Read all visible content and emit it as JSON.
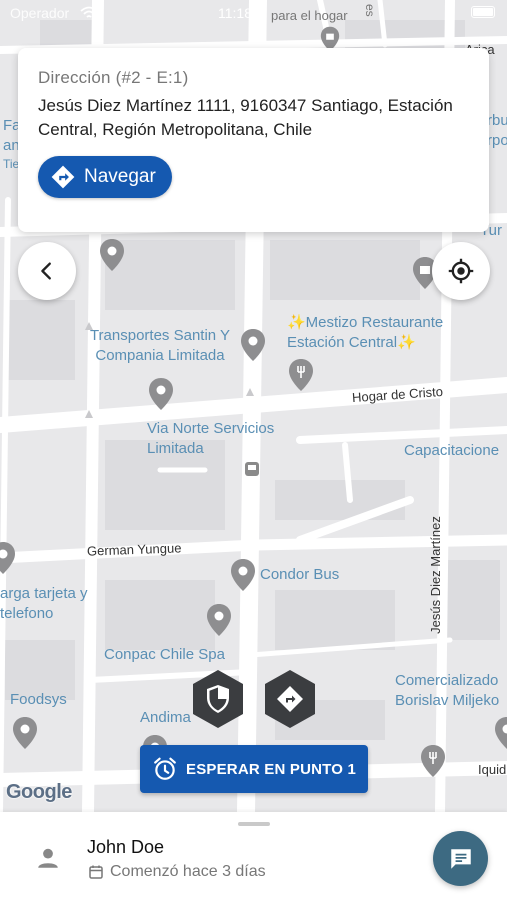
{
  "status_bar": {
    "carrier": "Operador",
    "time": "11:18"
  },
  "address_card": {
    "label": "Dirección (#2 - E:1)",
    "address": "Jesús Diez Martínez 1111, 9160347 Santiago, Estación Central, Región Metropolitana, Chile",
    "navigate_label": "Navegar",
    "navigate_icon": "directions-icon"
  },
  "map": {
    "labels": {
      "transportes": "Transportes Santin Y Compania Limitada",
      "mestizo": "✨Mestizo Restaurante Estación Central✨",
      "hogar_de_cristo": "Hogar de Cristo",
      "via_norte": "Via Norte Servicios Limitada",
      "capacitacione": "Capacitacione",
      "german_yungue": "German Yungue",
      "condor_bus": "Condor Bus",
      "carga_tarjeta": "arga tarjeta y telefono",
      "conpac": "Conpac Chile Spa",
      "jesus_diez": "Jesús Diez Martínez",
      "comercializado": "Comercializado Borislav Miljeko",
      "foodsys": "Foodsys",
      "andima": "Andima",
      "liquid": "Iquid",
      "para_el_hogar": "para el hogar",
      "tienda": "tienda de artículos",
      "fa": "Fa",
      "an": "an",
      "tie": "Tie",
      "rbu": "rbu",
      "rpo": "rpo",
      "tur": "Tur",
      "arica": "Arica",
      "es": "es"
    },
    "google_logo": "Google"
  },
  "controls": {
    "back_icon": "chevron-left-icon",
    "locate_icon": "my-location-icon",
    "shield_icon": "shield-icon",
    "route_icon": "directions-icon"
  },
  "wait_button": {
    "label": "ESPERAR EN PUNTO 1",
    "icon": "alarm-clock-icon"
  },
  "bottom_sheet": {
    "user_name": "John Doe",
    "started": "Comenzó hace 3 días",
    "chat_icon": "chat-icon"
  },
  "colors": {
    "primary": "#1559b0",
    "chat_fab": "#3d6a82",
    "map_bg": "#e8e8ea",
    "road": "#ffffff",
    "poi_label": "#5a8fb4"
  }
}
